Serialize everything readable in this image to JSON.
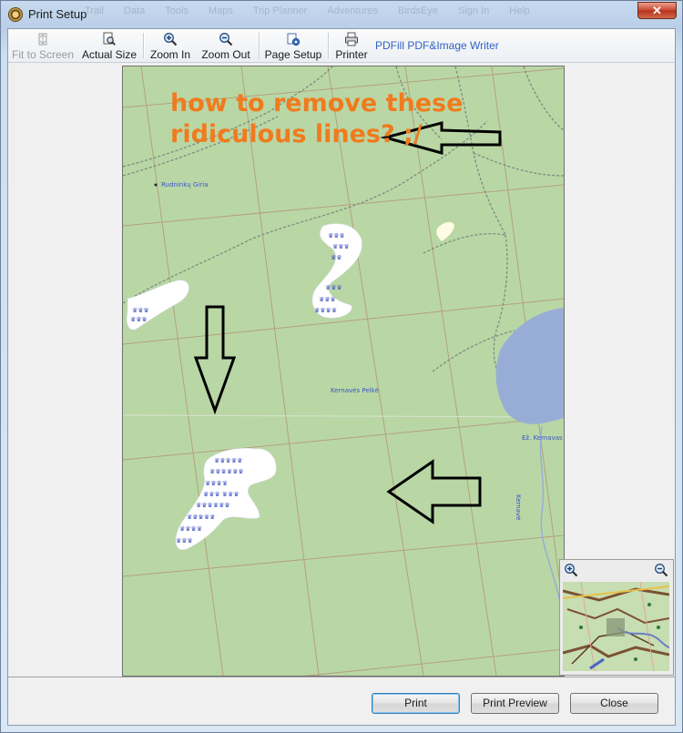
{
  "window": {
    "title": "Print Setup",
    "close_label": "✕",
    "background_menu": [
      "Trail",
      "Data",
      "Tools",
      "Maps",
      "Trip Planner",
      "Adventures",
      "BirdsEye",
      "Sign In",
      "Help"
    ]
  },
  "toolbar": {
    "fit_to_screen": "Fit to Screen",
    "actual_size": "Actual Size",
    "zoom_in": "Zoom In",
    "zoom_out": "Zoom Out",
    "page_setup": "Page Setup",
    "printer": "Printer",
    "printer_name": "PDFill PDF&Image Writer"
  },
  "map": {
    "annotation_line1": "how to remove these",
    "annotation_line2": "ridiculous lines? ;/",
    "labels": {
      "place1": "Rudninkų Giria",
      "place2": "Kernavės Pelkė",
      "lake": "Ež. Kernavas",
      "river": "Kernavė"
    },
    "colors": {
      "land": "#b9d7a5",
      "water": "#98add6",
      "annotation": "#f07b1e"
    }
  },
  "buttons": {
    "print": "Print",
    "print_preview": "Print Preview",
    "close": "Close"
  }
}
